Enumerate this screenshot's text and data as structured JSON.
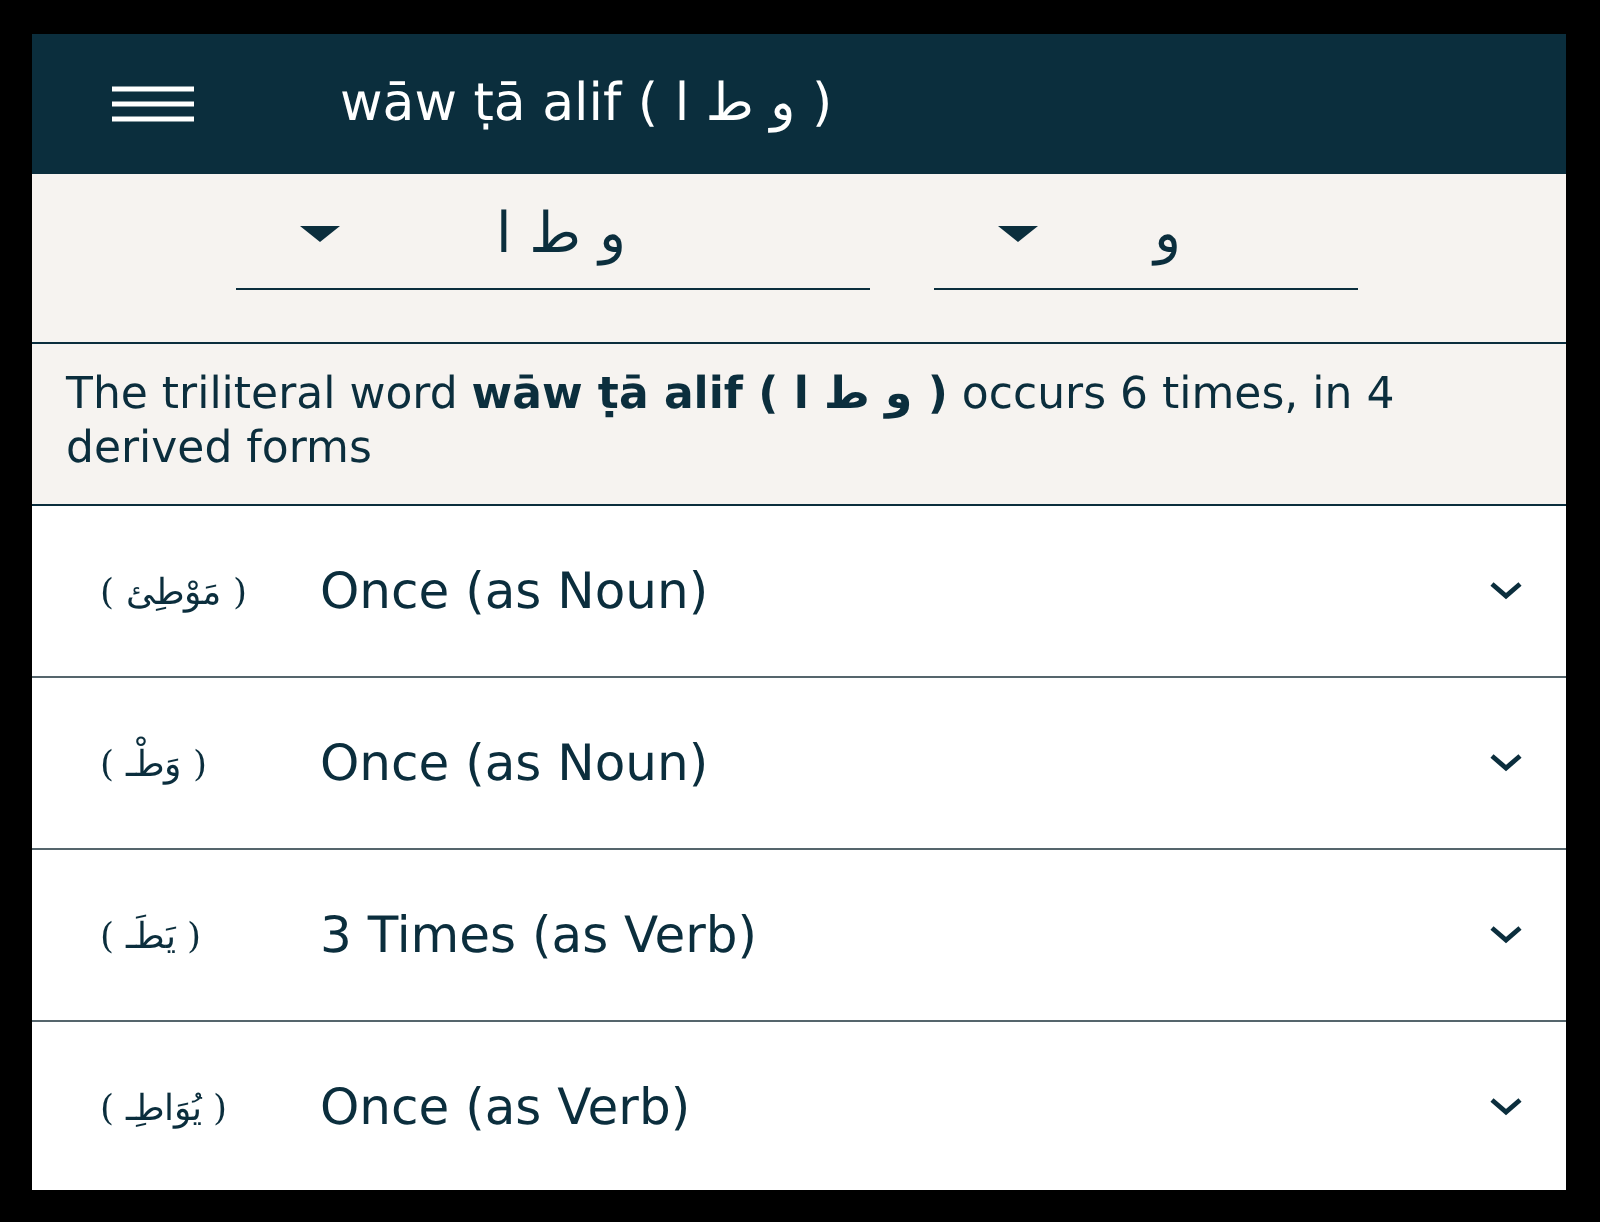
{
  "header": {
    "title": "wāw ṭā alif ( و ط ا )"
  },
  "root_selector": {
    "value": "و ط ا"
  },
  "letter_selector": {
    "value": "و"
  },
  "summary": "The triliteral word **wāw ṭā alif ( و ط ا )** occurs 6 times, in 4 derived forms",
  "forms": [
    {
      "arabic": "( مَوْطِئ )",
      "label": "Once (as Noun)",
      "expanded": false
    },
    {
      "arabic": "( وَطْـ )",
      "label": "Once (as Noun)",
      "expanded": false
    },
    {
      "arabic": "( يَطَـ )",
      "label": "3 Times (as Verb)",
      "expanded": false
    },
    {
      "arabic": "( يُوَاطِـ )",
      "label": "Once (as Verb)",
      "expanded": false
    }
  ]
}
